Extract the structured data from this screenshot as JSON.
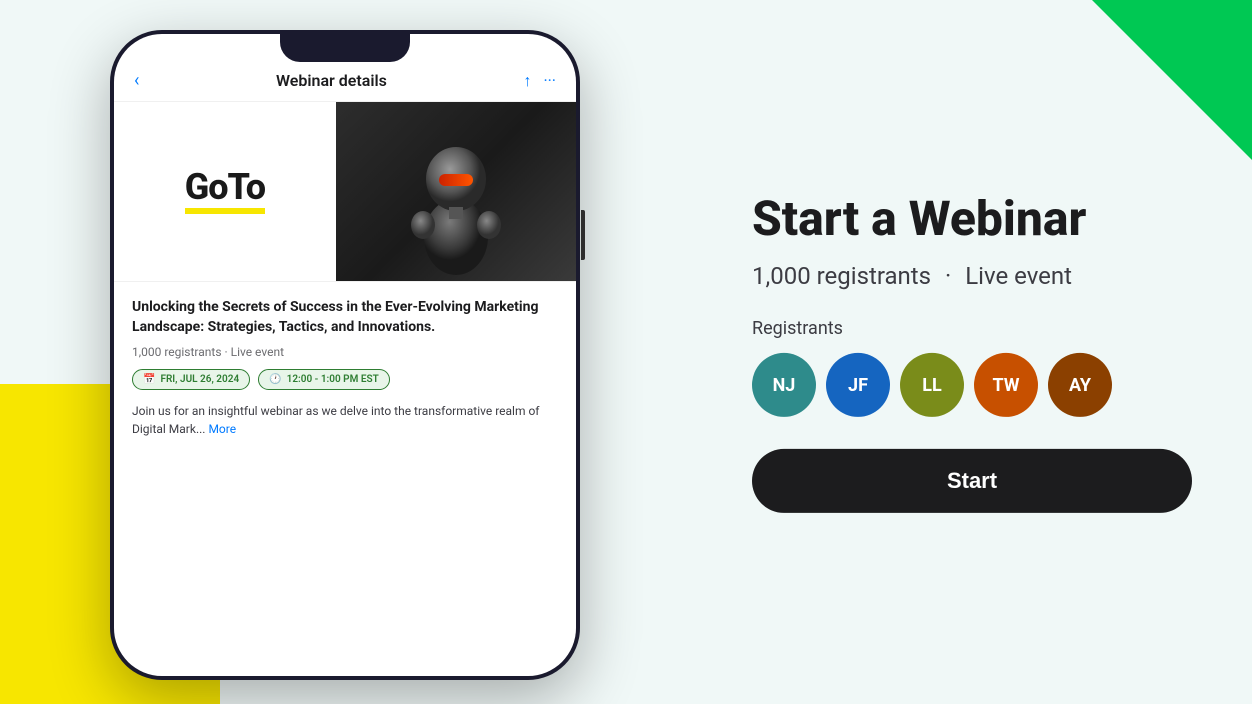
{
  "background": {
    "color": "#f0f8f7"
  },
  "phone": {
    "header": {
      "back_label": "‹",
      "title": "Webinar details",
      "upload_icon": "↑",
      "more_icon": "···"
    },
    "webinar": {
      "logo_text": "GoTo",
      "title": "Unlocking the Secrets of Success in the Ever-Evolving Marketing Landscape: Strategies, Tactics, and Innovations.",
      "meta": "1,000 registrants · Live event",
      "date_tag": "FRI, JUL 26, 2024",
      "time_tag": "12:00 - 1:00 PM EST",
      "description": "Join us for an insightful webinar as we delve into the transformative realm of Digital Mark...",
      "read_more": "More"
    }
  },
  "right_panel": {
    "title": "Start a Webinar",
    "subtitle_registrants": "1,000 registrants",
    "subtitle_dot": "·",
    "subtitle_event_type": "Live event",
    "registrants_label": "Registrants",
    "avatars": [
      {
        "initials": "NJ",
        "color": "#2e8b8b"
      },
      {
        "initials": "JF",
        "color": "#1565c0"
      },
      {
        "initials": "LL",
        "color": "#7a8c1a"
      },
      {
        "initials": "TW",
        "color": "#c75000"
      },
      {
        "initials": "AY",
        "color": "#8b4000"
      }
    ],
    "start_button_label": "Start"
  }
}
